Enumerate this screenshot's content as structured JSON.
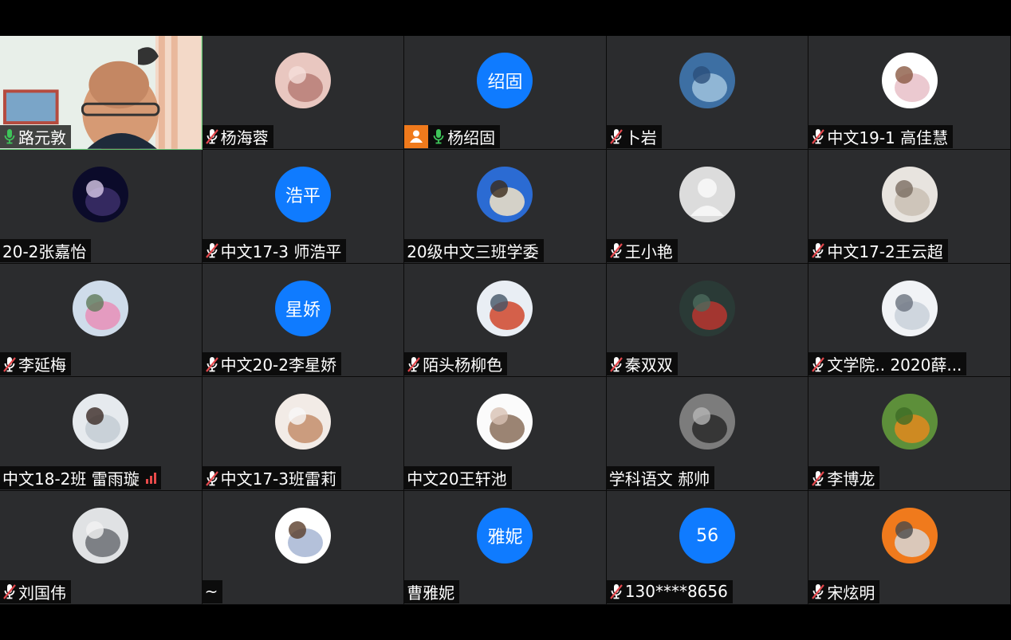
{
  "participants": [
    {
      "name": "路元敦",
      "mic": "on",
      "video": true
    },
    {
      "name": "杨海蓉",
      "mic": "muted",
      "avatar": "photo-baby-hand"
    },
    {
      "name": "杨绍固",
      "mic": "on",
      "avatar_text": "绍固",
      "host": true
    },
    {
      "name": "卜岩",
      "mic": "muted",
      "avatar": "photo-lake"
    },
    {
      "name": "中文19-1 高佳慧",
      "mic": "muted",
      "avatar": "photo-illustration-girl"
    },
    {
      "name": "20-2张嘉怡",
      "mic": "none",
      "avatar": "photo-night-girl"
    },
    {
      "name": "中文17-3 师浩平",
      "mic": "muted",
      "avatar_text": "浩平"
    },
    {
      "name": "20级中文三班学委",
      "mic": "none",
      "avatar": "photo-rabbit"
    },
    {
      "name": "王小艳",
      "mic": "muted",
      "avatar": "default-person"
    },
    {
      "name": "中文17-2王云超",
      "mic": "muted",
      "avatar": "photo-cat"
    },
    {
      "name": "李延梅",
      "mic": "muted",
      "avatar": "photo-blossom"
    },
    {
      "name": "中文20-2李星娇",
      "mic": "muted",
      "avatar_text": "星娇"
    },
    {
      "name": "陌头杨柳色",
      "mic": "muted",
      "avatar": "photo-snow-kid"
    },
    {
      "name": "秦双双",
      "mic": "muted",
      "avatar": "photo-flower-dark"
    },
    {
      "name": "文学院.. 2020薛...",
      "mic": "muted",
      "avatar": "photo-hand-white"
    },
    {
      "name": "中文18-2班 雷雨璇",
      "mic": "none",
      "avatar": "photo-seaside-girl",
      "signal": true
    },
    {
      "name": "中文17-3班雷莉",
      "mic": "muted",
      "avatar": "photo-girl-flower"
    },
    {
      "name": "中文20王轩池",
      "mic": "none",
      "avatar": "photo-sketch-girl"
    },
    {
      "name": "学科语文 郝帅",
      "mic": "none",
      "avatar": "photo-bw-couple"
    },
    {
      "name": "李博龙",
      "mic": "muted",
      "avatar": "photo-gourd-grass"
    },
    {
      "name": "刘国伟",
      "mic": "muted",
      "avatar": "photo-white-box"
    },
    {
      "name": "~",
      "mic": "none",
      "avatar": "photo-cartoon-bunny-girl"
    },
    {
      "name": "曹雅妮",
      "mic": "none",
      "avatar_text": "雅妮"
    },
    {
      "name": "130****8656",
      "mic": "muted",
      "avatar_text": "56"
    },
    {
      "name": "宋炫明",
      "mic": "muted",
      "avatar": "photo-hoodie-orange"
    }
  ],
  "colors": {
    "tile_bg": "#2b2c2e",
    "text_avatar_bg": "#0f7bff",
    "host_badge": "#f07a1c",
    "mic_on": "#3ec55a",
    "mic_muted": "#e5484d"
  }
}
